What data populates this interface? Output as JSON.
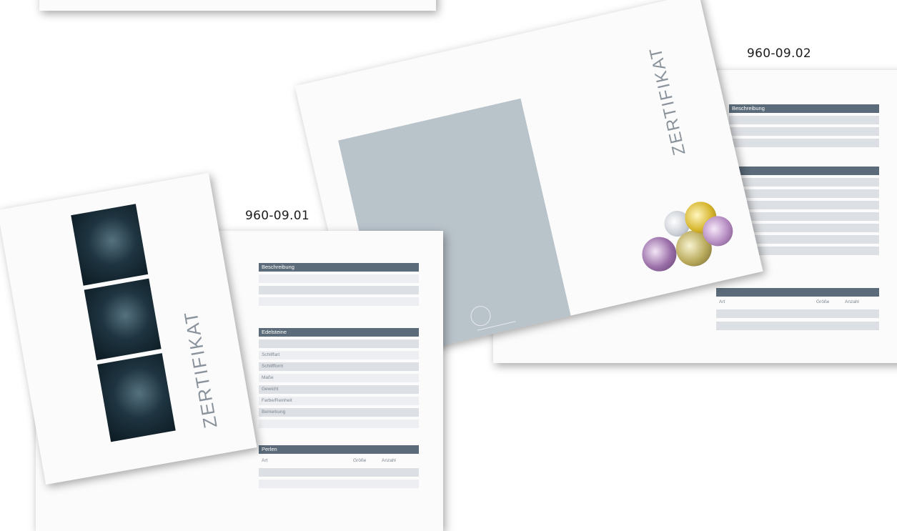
{
  "labels": {
    "code_a": "960-09.01",
    "code_b": "960-09.02"
  },
  "cover": {
    "title": "ZERTIFIKAT"
  },
  "cover2": {
    "title": "ZERTIFIKAT"
  },
  "form_a": {
    "section1": "Beschreibung",
    "section2": "Edelsteine",
    "fields2": [
      "Schliffart",
      "Schliffform",
      "Maße",
      "Gewicht",
      "Farbe/Reinheit",
      "Bemerkung"
    ],
    "section3": "Perlen",
    "section3_cols": [
      "Art",
      "Größe",
      "Anzahl"
    ]
  },
  "form_b": {
    "section1": "Beschreibung",
    "section3_cols": [
      "Art",
      "Größe",
      "Anzahl"
    ]
  },
  "colors": {
    "header_bar": "#5b6b79",
    "row_grey": "#dcdfe3",
    "cover_panel": "#b9c3ca",
    "title_grey": "#8a939b"
  }
}
